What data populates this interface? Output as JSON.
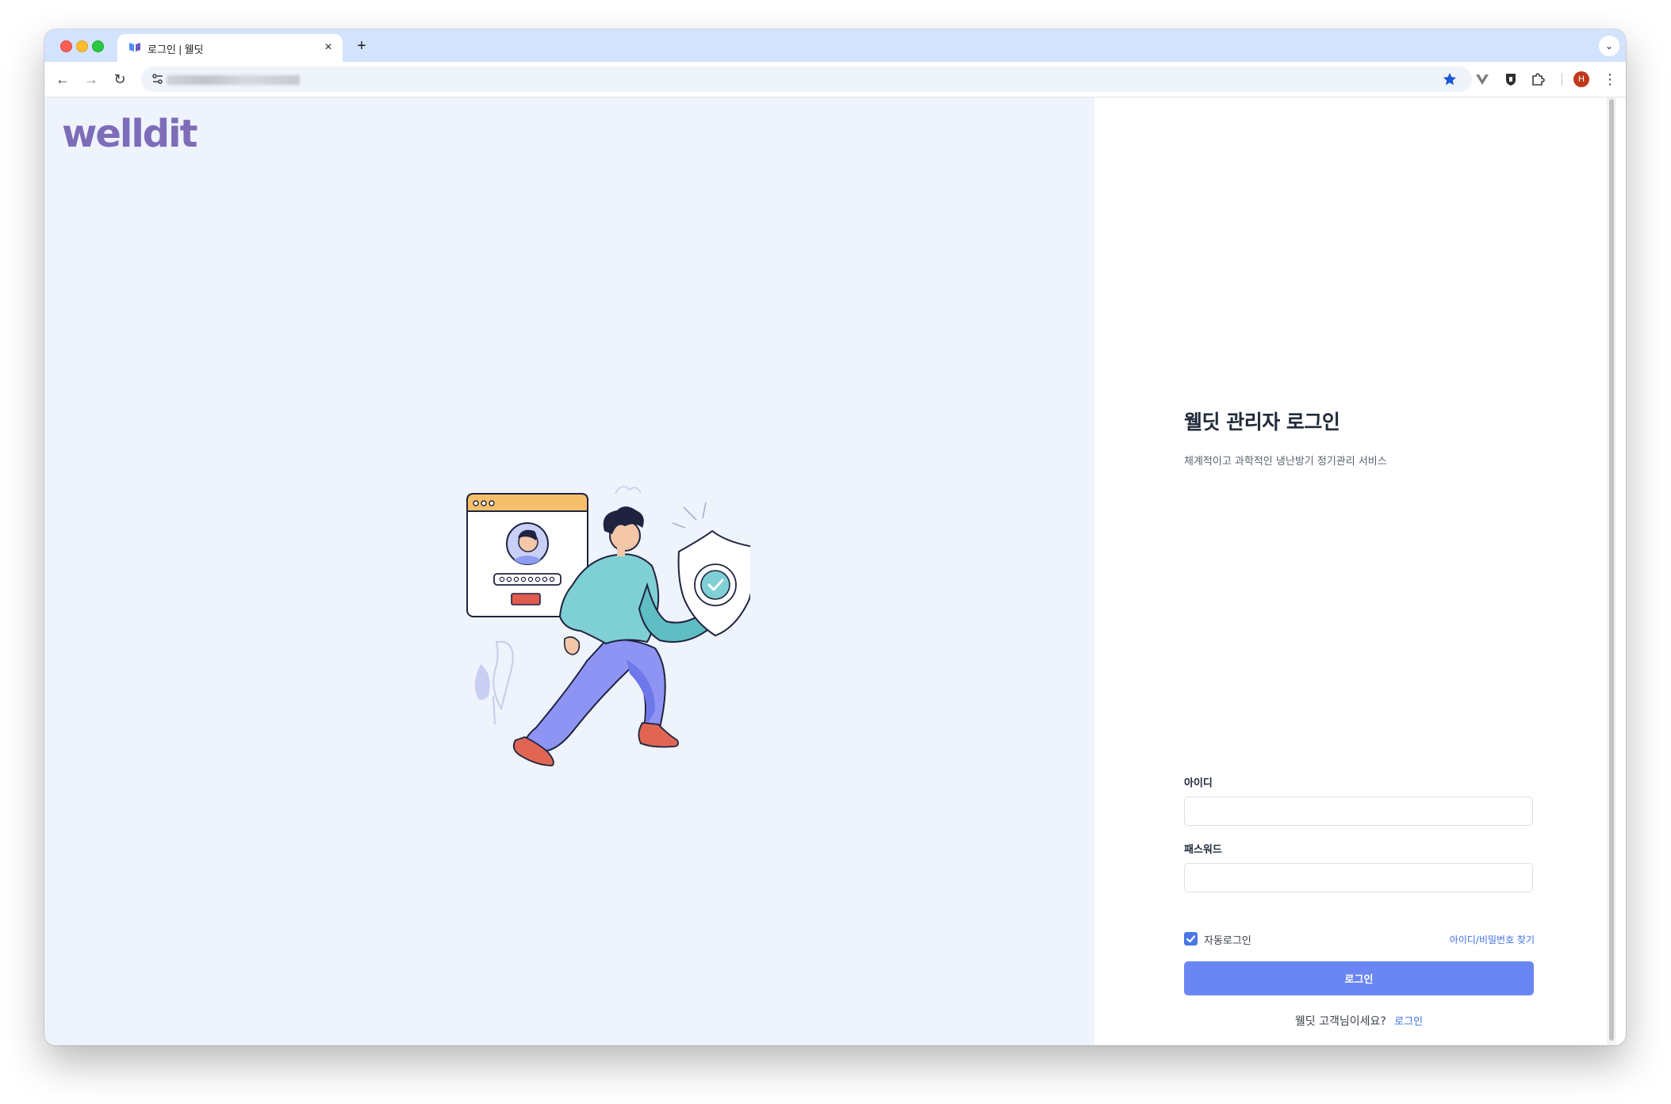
{
  "browser": {
    "tab_title": "로그인 | 웰딧",
    "tab_close": "×",
    "new_tab": "+",
    "tab_menu": "⌄",
    "avatar_initial": "H",
    "colors": {
      "tabstrip": "#d3e3fd",
      "omnibox": "#eff3fa",
      "star": "#1a56d6"
    }
  },
  "nav": {
    "back_icon": "←",
    "forward_icon": "→",
    "reload_icon": "↻",
    "menu_icon": "⋮"
  },
  "brand": {
    "logo_text": "welldit",
    "logo_color": "#7d6cb8"
  },
  "login": {
    "title": "웰딧 관리자 로그인",
    "subtitle": "체계적이고 과학적인 냉난방기 정기관리 서비스",
    "id_label": "아이디",
    "id_value": "",
    "password_label": "패스워드",
    "password_value": "",
    "remember_label": "자동로그인",
    "remember_checked": true,
    "find_link": "아이디/비밀번호 찾기",
    "submit_label": "로그인",
    "customer_prompt": "웰딧 고객님이세요?",
    "customer_link": "로그인"
  },
  "colors": {
    "left_bg": "#eef3fc",
    "primary_button": "#6a86f2",
    "link": "#3c6fe6",
    "checkbox": "#4a78e8"
  }
}
